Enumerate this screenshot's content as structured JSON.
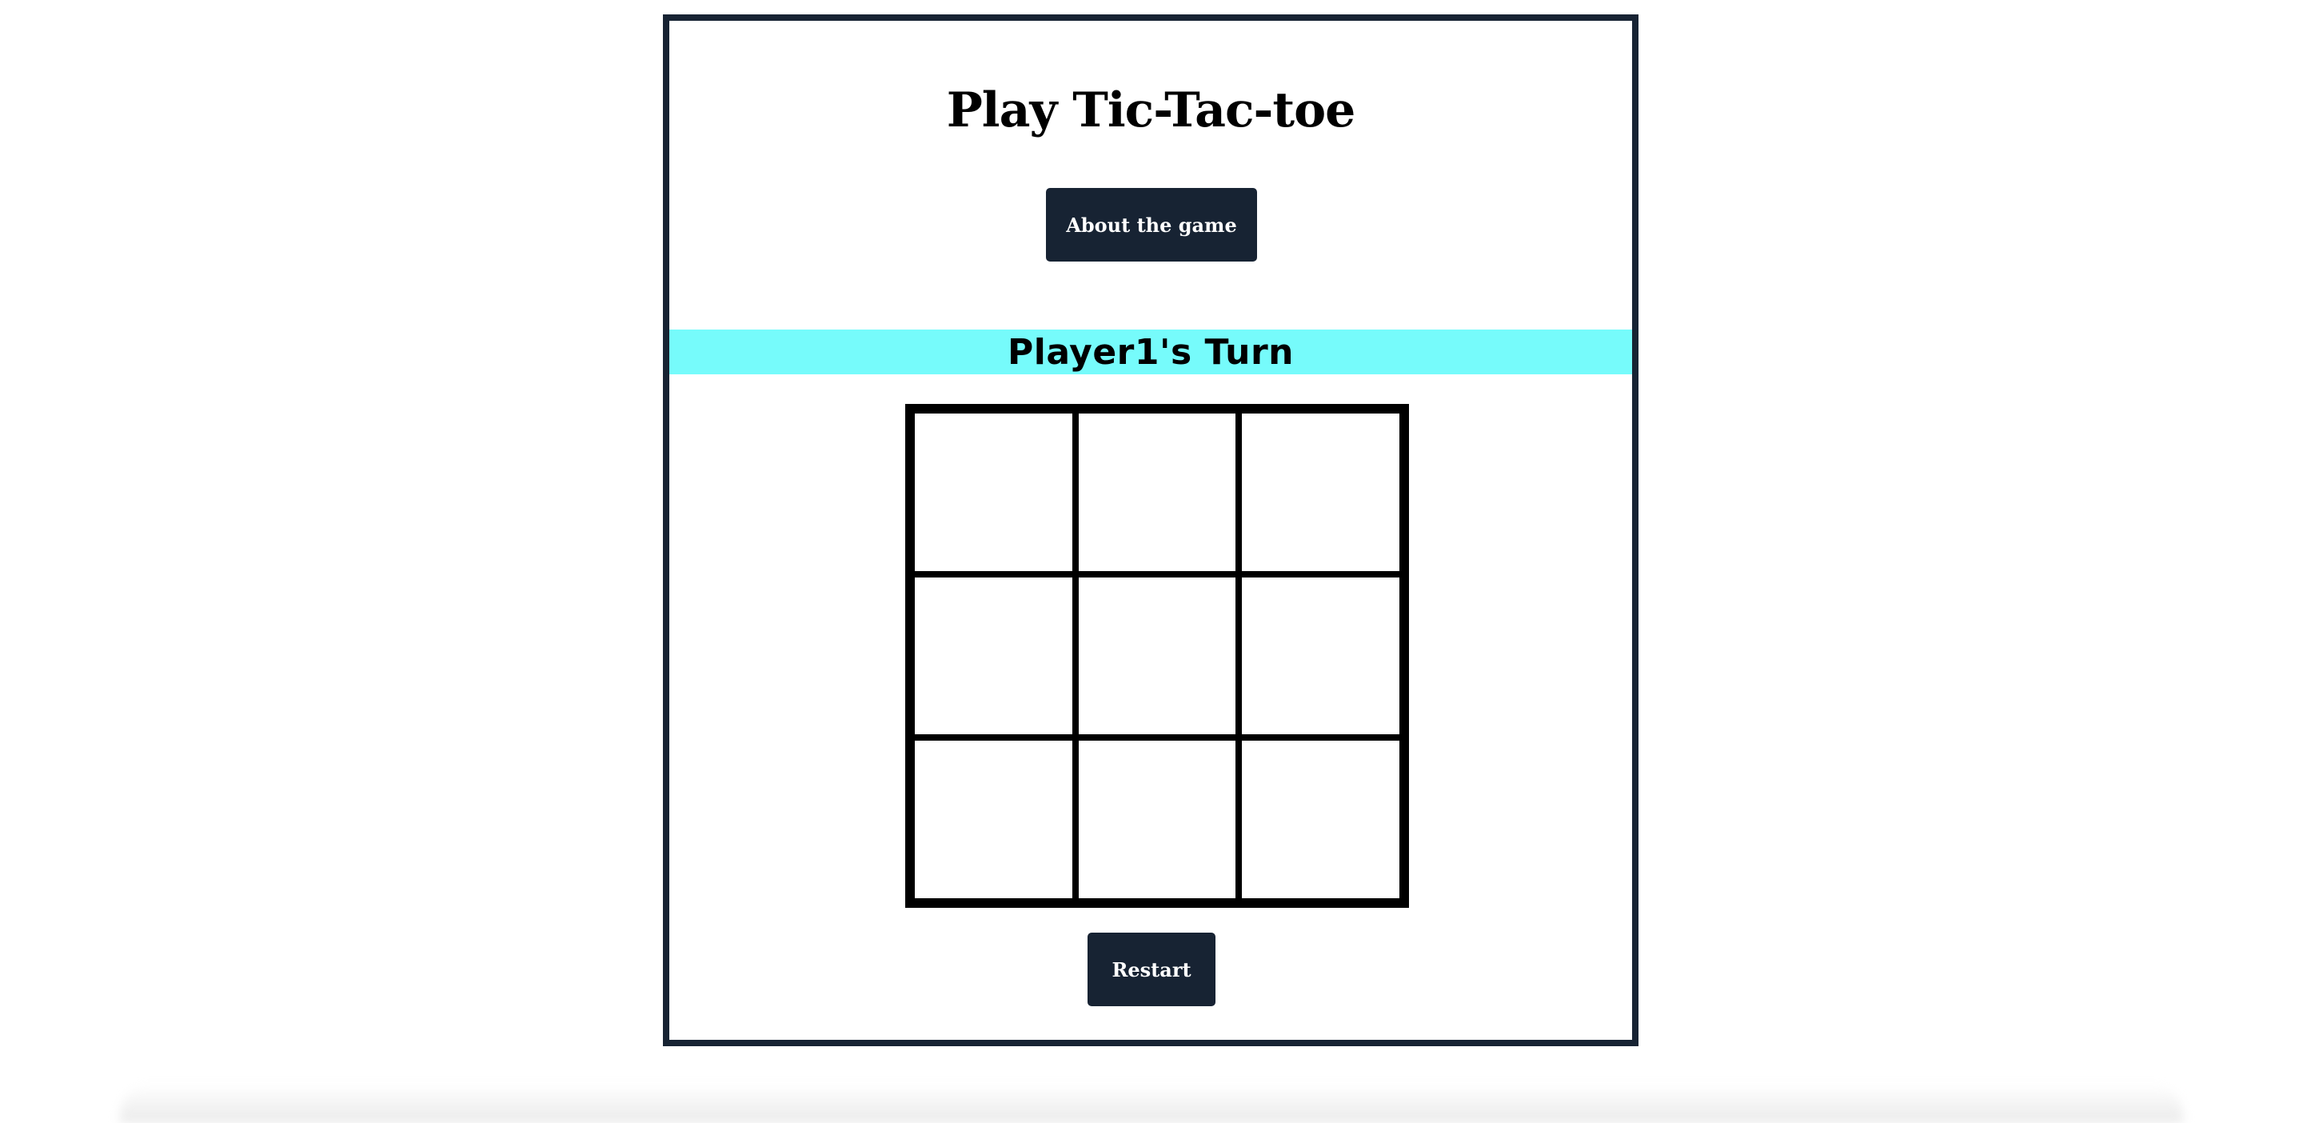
{
  "game": {
    "title": "Play Tic-Tac-toe",
    "about_button_label": "About the game",
    "turn_status": "Player1's Turn",
    "restart_button_label": "Restart",
    "board": {
      "cells": [
        "",
        "",
        "",
        "",
        "",
        "",
        "",
        "",
        ""
      ]
    }
  },
  "colors": {
    "panel_border": "#172333",
    "button_background": "#172333",
    "button_text": "#ffffff",
    "turn_banner": "#76fbfb",
    "board_lines": "#000000"
  }
}
